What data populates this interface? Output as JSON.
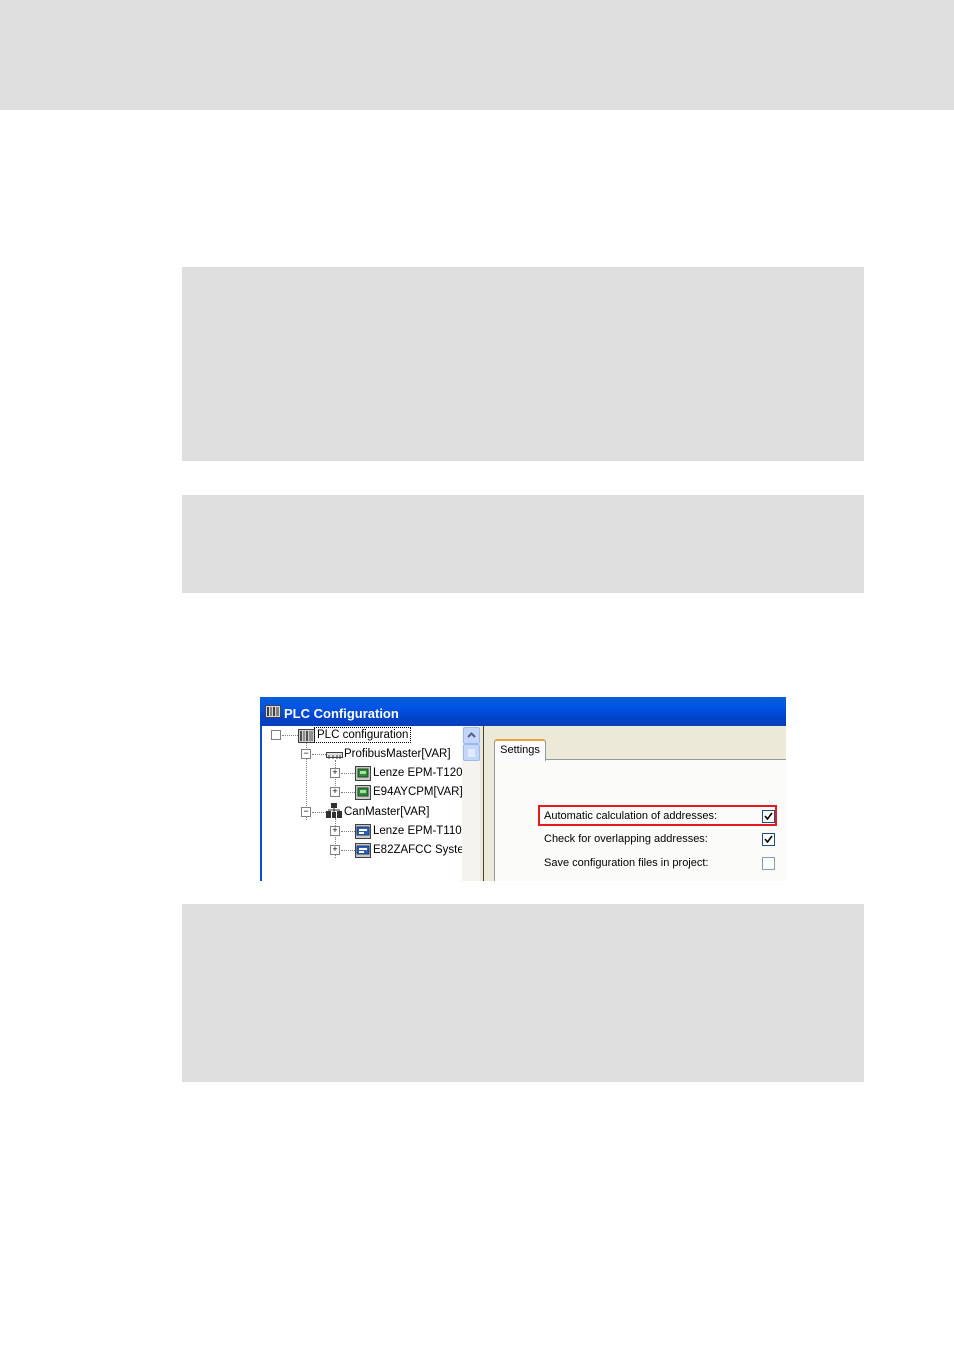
{
  "window": {
    "title": "PLC Configuration"
  },
  "tree": {
    "items": [
      {
        "label": "PLC configuration",
        "icon": "plc-rack-icon",
        "expand": "⊟",
        "level": 0
      },
      {
        "label": "ProfibusMaster[VAR]",
        "icon": "bus-connector-icon",
        "expand": "⊟",
        "level": 1
      },
      {
        "label": "Lenze EPM-T120",
        "icon": "module-green-icon",
        "expand": "⊞",
        "level": 2
      },
      {
        "label": "E94AYCPM[VAR]",
        "icon": "module-green-icon",
        "expand": "⊞",
        "level": 2
      },
      {
        "label": "CanMaster[VAR]",
        "icon": "network-nodes-icon",
        "expand": "⊟",
        "level": 1
      },
      {
        "label": "Lenze EPM-T110",
        "icon": "module-blue-icon",
        "expand": "⊞",
        "level": 2
      },
      {
        "label": "E82ZAFCC Syste",
        "icon": "module-blue-icon",
        "expand": "⊞",
        "level": 2
      }
    ]
  },
  "settings": {
    "tab_label": "Settings",
    "options": [
      {
        "label": "Automatic calculation of addresses:",
        "checked": true,
        "highlighted": true
      },
      {
        "label": "Check for overlapping addresses:",
        "checked": true,
        "highlighted": false
      },
      {
        "label": "Save configuration files in project:",
        "checked": false,
        "highlighted": false
      }
    ]
  },
  "colors": {
    "titlebar": "#0055e5",
    "highlight": "#e51b24",
    "band": "#dedede"
  }
}
